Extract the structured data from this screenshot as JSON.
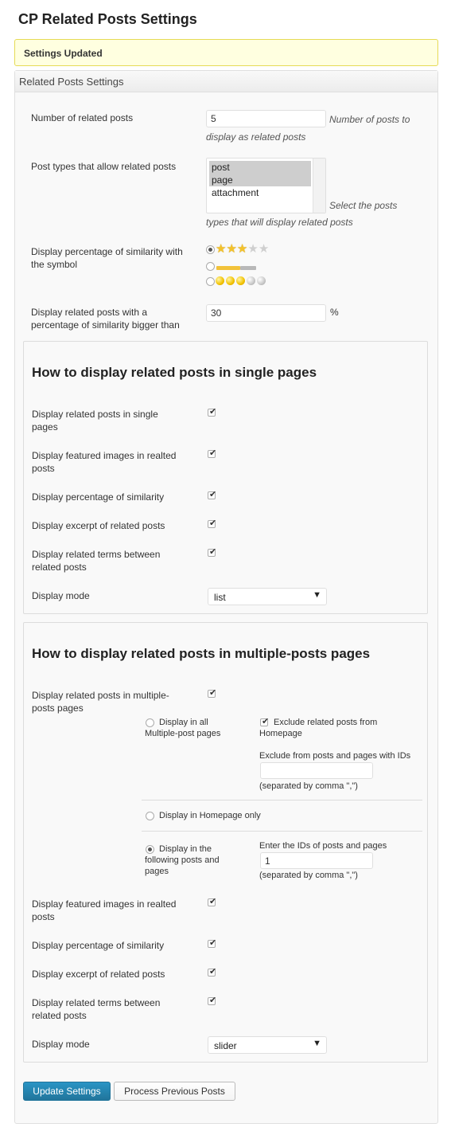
{
  "page_title": "CP Related Posts Settings",
  "notice": "Settings Updated",
  "box_title": "Related Posts Settings",
  "general": {
    "num_posts_label": "Number of related posts",
    "num_posts_value": "5",
    "num_posts_desc_1": "Number of posts to",
    "num_posts_desc_2": "display as related posts",
    "post_types_label": "Post types that allow related posts",
    "post_types_options": [
      "post",
      "page",
      "attachment"
    ],
    "post_types_desc_1": "Select the posts",
    "post_types_desc_2": "types that will display related posts",
    "similarity_symbol_label_1": "Display percentage of similarity with",
    "similarity_symbol_label_2": "the symbol",
    "similarity_threshold_label_1": "Display related posts with a",
    "similarity_threshold_label_2": "percentage of similarity bigger than",
    "similarity_threshold_value": "30",
    "similarity_threshold_unit": "%",
    "stars": "★"
  },
  "single": {
    "title": "How to display related posts in single pages",
    "display_related_1": "Display related posts in single",
    "display_related_2": "pages",
    "featured_1": "Display featured images in realted",
    "featured_2": "posts",
    "percentage": "Display percentage of similarity",
    "excerpt": "Display excerpt of related posts",
    "terms_1": "Display related terms between",
    "terms_2": "related posts",
    "mode_label": "Display mode",
    "mode_value": "list",
    "check": "✔",
    "arrow": "▼"
  },
  "multiple": {
    "title": "How to display related posts in multiple-posts pages",
    "display_related_1": "Display related posts in multiple-",
    "display_related_2": "posts pages",
    "all_pages_1": "Display in all",
    "all_pages_2": "Multiple-post pages",
    "exclude_home_1": "Exclude related posts from",
    "exclude_home_2": "Homepage",
    "exclude_ids_label": "Exclude from posts and pages with IDs",
    "exclude_ids_value": "",
    "separated_note": "(separated by comma \",\")",
    "homepage_only": "Display in Homepage only",
    "following_1": "Display in the",
    "following_2": "following posts and",
    "following_3": "pages",
    "enter_ids_label": "Enter the IDs of posts and pages",
    "enter_ids_value": "1",
    "featured_1": "Display featured images in realted",
    "featured_2": "posts",
    "percentage": "Display percentage of similarity",
    "excerpt": "Display excerpt of related posts",
    "terms_1": "Display related terms between",
    "terms_2": "related posts",
    "mode_label": "Display mode",
    "mode_value": "slider"
  },
  "buttons": {
    "update": "Update Settings",
    "process": "Process Previous Posts"
  }
}
